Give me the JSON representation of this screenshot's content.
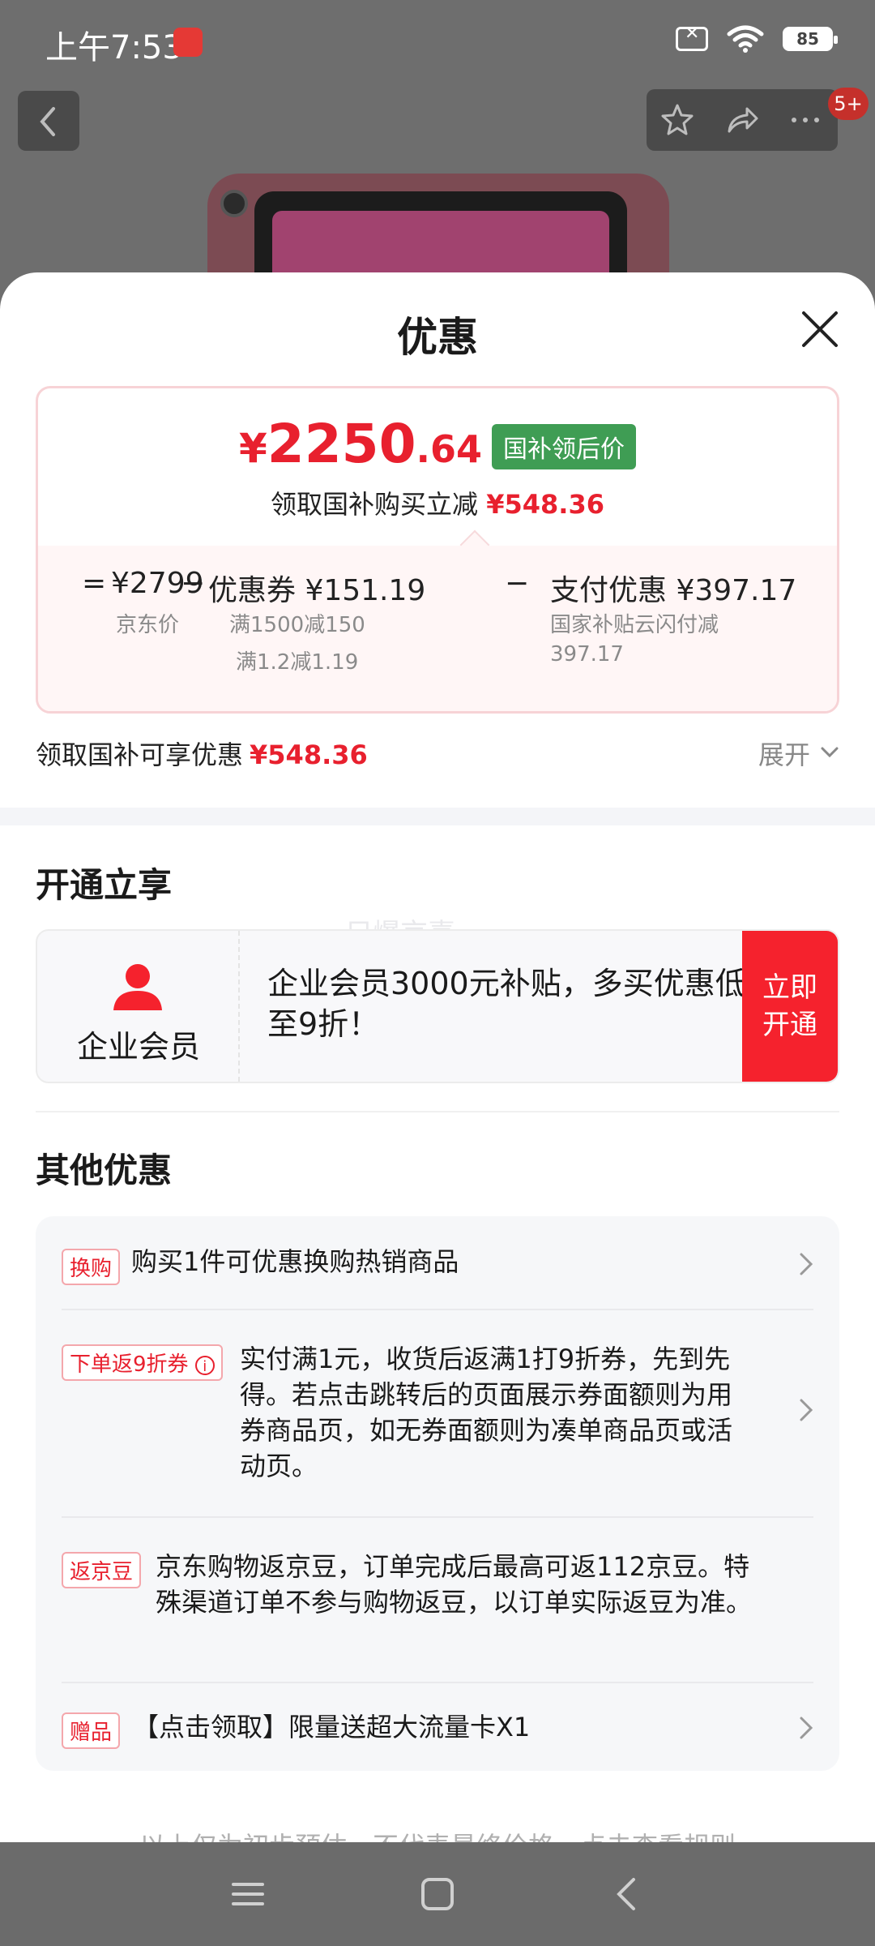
{
  "status_bar": {
    "time": "上午7:53",
    "battery": "85"
  },
  "header": {
    "cart_badge": "5+"
  },
  "sheet": {
    "title": "优惠",
    "price": {
      "currency": "¥",
      "integer": "2250",
      "decimal": ".64",
      "tag": "国补领后价",
      "sub_label": "领取国补购买立减",
      "sub_value": "¥548.36"
    },
    "breakdown": {
      "eq": "=",
      "jd_price": "¥2799",
      "jd_price_label": "京东价",
      "minus1": "−",
      "coupon": "优惠券 ¥151.19",
      "coupon_note1": "满1500减150",
      "coupon_note2": "满1.2减1.19",
      "minus2": "−",
      "pay": "支付优惠 ¥397.17",
      "pay_note1": "国家补贴云闪付减",
      "pay_note2": "397.17"
    },
    "enjoy": {
      "label": "领取国补可享优惠",
      "value": "¥548.36",
      "expand": "展开"
    },
    "open_section": {
      "title": "开通立享",
      "watermark": "只爆京喜",
      "member_name": "企业会员",
      "member_desc": "企业会员3000元补贴，多买优惠低至9折！",
      "button": "立即开通"
    },
    "other_section": {
      "title": "其他优惠",
      "items": [
        {
          "tag": "换购",
          "text": "购买1件可优惠换购热销商品"
        },
        {
          "tag": "下单返9折券",
          "text": "实付满1元，收货后返满1打9折券，先到先得。若点击跳转后的页面展示券面额则为用券商品页，如无券面额则为凑单商品页或活动页。"
        },
        {
          "tag": "返京豆",
          "text": "京东购物返京豆，订单完成后最高可返112京豆。特殊渠道订单不参与购物返豆，以订单实际返豆为准。"
        },
        {
          "tag": "赠品",
          "text": "【点击领取】限量送超大流量卡X1"
        }
      ]
    },
    "footer_hint": "以上仅为初步预估，不代表最终价格，点击查看规则"
  },
  "colors": {
    "accent_red": "#e8202e",
    "tag_green": "#3f9d54",
    "button_red": "#f5222d"
  }
}
